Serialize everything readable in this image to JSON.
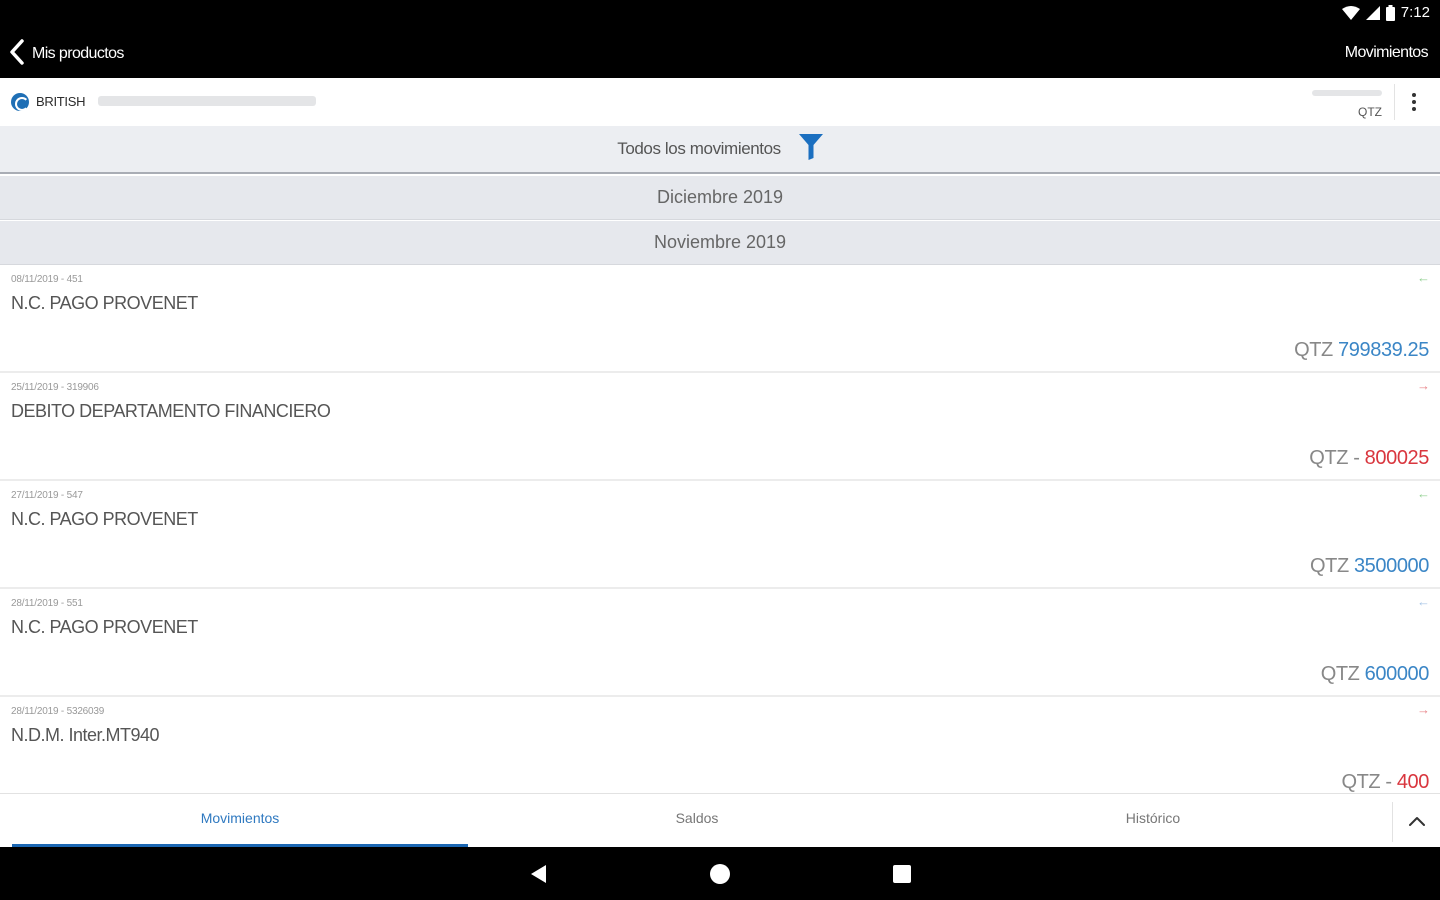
{
  "status_bar": {
    "time": "7:12"
  },
  "app_bar": {
    "back_label": "Mis productos",
    "title": "Movimientos"
  },
  "account": {
    "name": "BRITISH",
    "currency": "QTZ"
  },
  "filter": {
    "label": "Todos los movimientos"
  },
  "months": [
    "Diciembre 2019",
    "Noviembre 2019"
  ],
  "transactions": [
    {
      "ref": "08/11/2019 - 451",
      "description": "N.C. PAGO PROVENET",
      "currency": "QTZ",
      "amount": "799839.25",
      "direction": "credit"
    },
    {
      "ref": "25/11/2019 - 319906",
      "description": "DEBITO DEPARTAMENTO FINANCIERO",
      "currency": "QTZ - ",
      "amount": "800025",
      "direction": "debit"
    },
    {
      "ref": "27/11/2019 - 547",
      "description": "N.C. PAGO PROVENET",
      "currency": "QTZ",
      "amount": "3500000",
      "direction": "credit"
    },
    {
      "ref": "28/11/2019 - 551",
      "description": "N.C. PAGO PROVENET",
      "currency": "QTZ",
      "amount": "600000",
      "direction": "credit"
    },
    {
      "ref": "28/11/2019 - 5326039",
      "description": "N.D.M. Inter.MT940",
      "currency": "QTZ - ",
      "amount": "400",
      "direction": "debit"
    }
  ],
  "tabs": [
    {
      "label": "Movimientos",
      "active": true
    },
    {
      "label": "Saldos",
      "active": false
    },
    {
      "label": "Histórico",
      "active": false
    }
  ],
  "colors": {
    "credit": "#3b86c6",
    "debit": "#d9363e",
    "accent": "#1b67b3",
    "filter_icon": "#1b6fc0"
  }
}
